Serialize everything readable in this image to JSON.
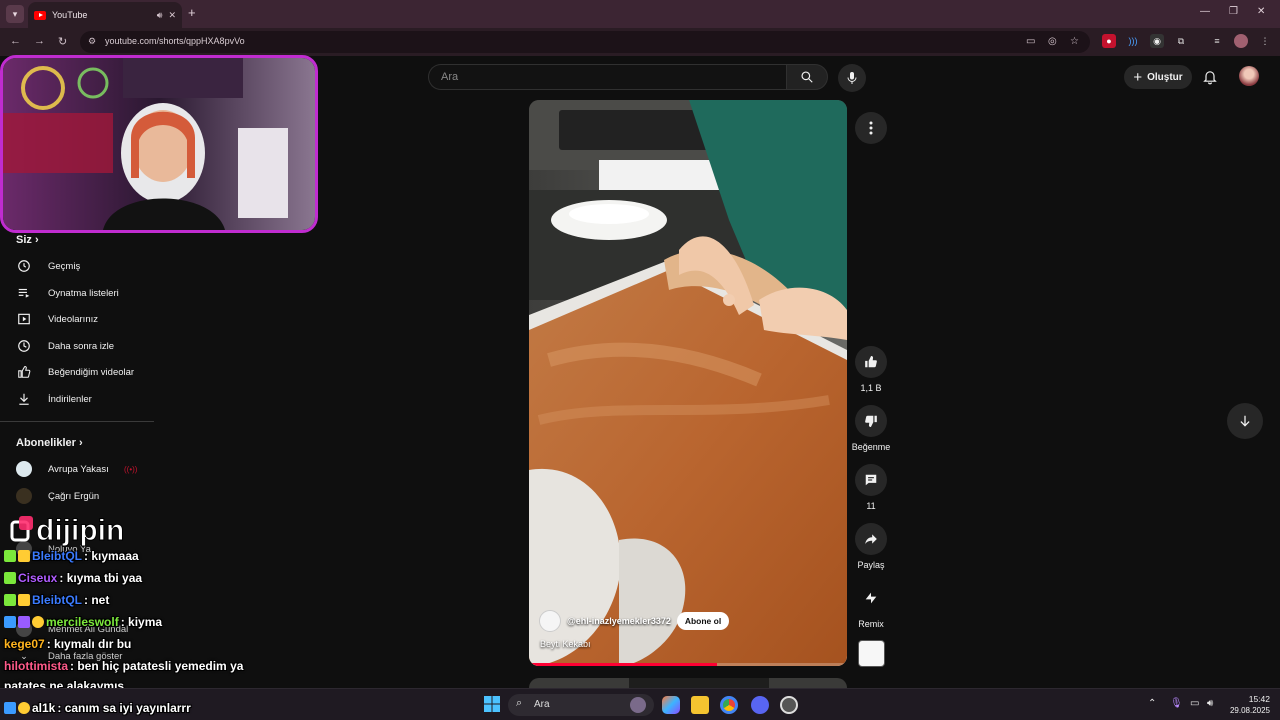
{
  "browser": {
    "tab_title": "YouTube",
    "url": "youtube.com/shorts/qppHXA8pvVo"
  },
  "header": {
    "search_placeholder": "Ara",
    "create_label": "Oluştur"
  },
  "sidebar": {
    "you_heading": "Siz",
    "you_items": [
      {
        "label": "Geçmiş",
        "icon": "history-icon"
      },
      {
        "label": "Oynatma listeleri",
        "icon": "playlists-icon"
      },
      {
        "label": "Videolarınız",
        "icon": "your-videos-icon"
      },
      {
        "label": "Daha sonra izle",
        "icon": "watch-later-icon"
      },
      {
        "label": "Beğendiğim videolar",
        "icon": "liked-videos-icon"
      },
      {
        "label": "İndirilenler",
        "icon": "downloads-icon"
      }
    ],
    "subs_heading": "Abonelikler",
    "subscriptions": [
      {
        "label": "Avrupa Yakası"
      },
      {
        "label": "Çağrı Ergün"
      },
      {
        "label": "Noluyo Ya"
      },
      {
        "label": "Mehmet Ali Gündal"
      }
    ],
    "show_more": "Daha fazla göster"
  },
  "short": {
    "channel": "@ehl-inazlyemekler3372",
    "subscribe": "Abone ol",
    "title": "Beyti Kekabı",
    "progress": 0.59
  },
  "actions": {
    "likes": "1,1 B",
    "dislike": "Beğenme",
    "comments": "11",
    "share": "Paylaş",
    "remix": "Remix"
  },
  "overlay": {
    "brand": "dijipin",
    "chat": [
      {
        "user": "BleibtQL",
        "message": ": kıymaaa",
        "color": "#3b7bff"
      },
      {
        "user": "Ciseux",
        "message": ": kıyma tbi yaa",
        "color": "#b05cff"
      },
      {
        "user": "BleibtQL",
        "message": ": net",
        "color": "#3b7bff"
      },
      {
        "user": "mercileswolf",
        "message": ": kiyma",
        "color": "#7be83b"
      },
      {
        "user": "kege07",
        "message": ": kıymalı dır bu",
        "color": "#ffb41e"
      },
      {
        "user": "hilottimista",
        "message": ": ben hiç patatesli yemedim ya",
        "color": "#ff5a8a"
      },
      {
        "user": "",
        "message": "patates ne alakaymıs",
        "color": "#ffffff"
      },
      {
        "user": "al1k",
        "message": ": canım sa iyi yayınlarrr",
        "color": "#ffffff"
      }
    ]
  },
  "taskbar": {
    "search_text": "Ara",
    "time": "15:42",
    "date": "29.08.2025"
  },
  "colors": {
    "yt_red": "#ff0033",
    "webcam_border": "#c02cd0",
    "browser_frame": "#3c2533"
  }
}
